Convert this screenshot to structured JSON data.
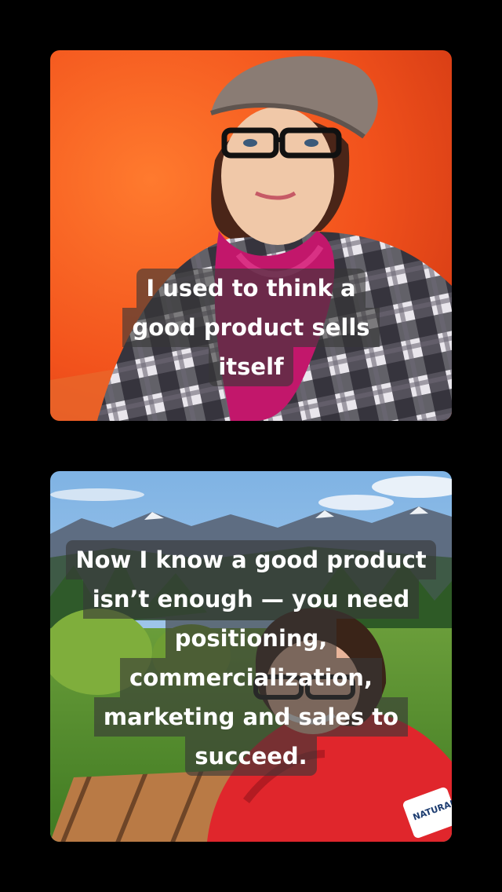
{
  "slides": [
    {
      "caption_lines": [
        "I used to think a",
        "good product sells",
        "itself"
      ],
      "colors": {
        "background": "#f2521c",
        "scarf": "#c2176b",
        "shirt_dark": "#2c2a33",
        "shirt_light": "#e7e3ea"
      }
    },
    {
      "caption_lines": [
        "Now I know a good product",
        "isn’t enough — you need",
        "positioning,",
        "commercialization,",
        "marketing and sales to",
        "succeed."
      ],
      "badge_text": "NATURAL",
      "colors": {
        "sky": "#9ec6ea",
        "grass": "#4f8a2a",
        "jacket": "#e0262c",
        "table": "#b97a45"
      }
    }
  ]
}
